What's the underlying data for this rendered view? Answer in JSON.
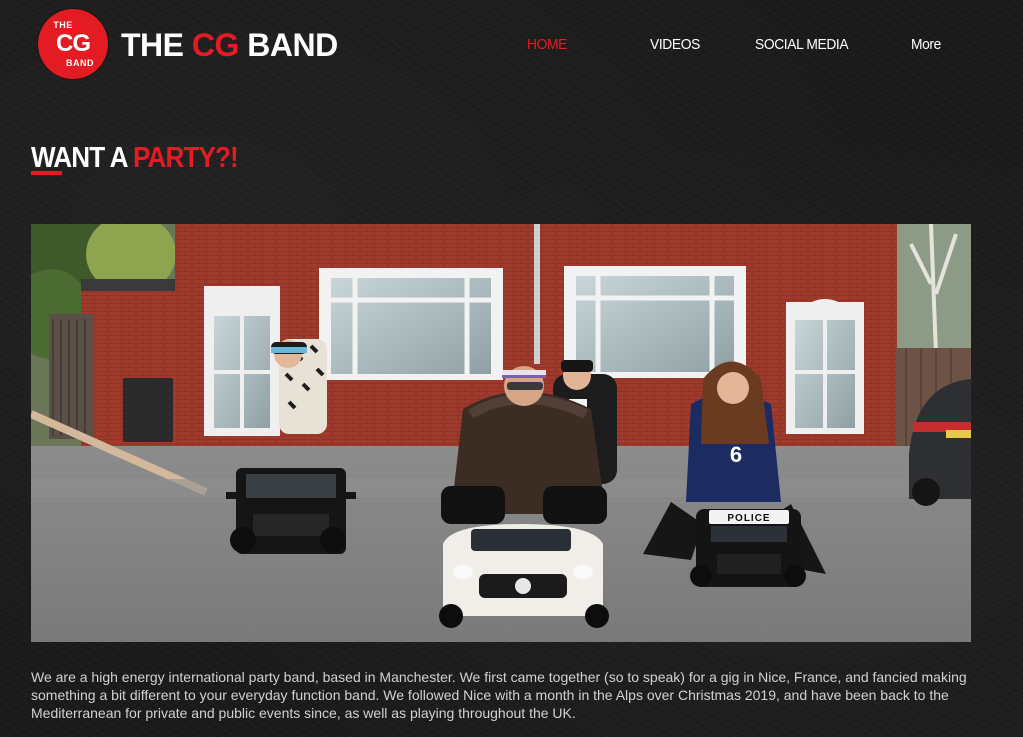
{
  "brand": {
    "badge_top": "THE",
    "badge_mid": "CG",
    "badge_bottom": "BAND",
    "name_prefix": "THE ",
    "name_accent": "CG",
    "name_suffix": " BAND",
    "accent_color": "#e31b23"
  },
  "nav": {
    "items": [
      {
        "label": "HOME",
        "active": true
      },
      {
        "label": "VIDEOS",
        "active": false
      },
      {
        "label": "SOCIAL MEDIA",
        "active": false
      },
      {
        "label": "More",
        "active": false
      }
    ]
  },
  "headline": {
    "prefix": "WANT A ",
    "accent": "PARTY?!"
  },
  "hero": {
    "police_label": "POLICE",
    "jersey_number": "6"
  },
  "intro": {
    "text": "We are a high energy international party band, based in Manchester. We first came together (so to speak) for a gig in Nice, France, and fancied making something a bit different to your everyday function band. We followed Nice with a month in the Alps over Christmas 2019, and have been back to the Mediterranean for private and public events since, as well as playing throughout the UK."
  }
}
